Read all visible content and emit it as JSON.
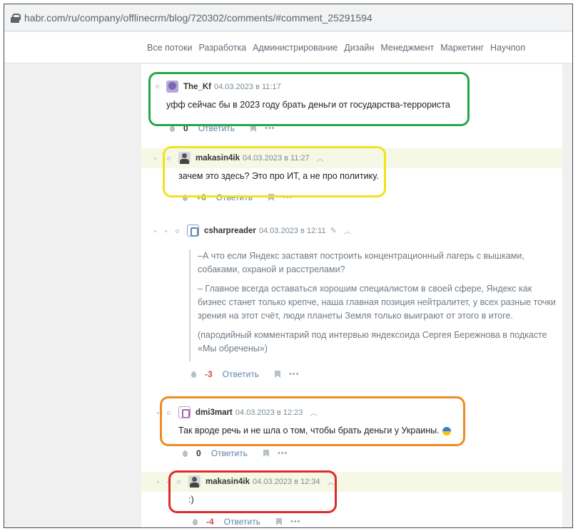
{
  "browser": {
    "url": "habr.com/ru/company/offlinecrm/blog/720302/comments/#comment_25291594"
  },
  "nav": {
    "items": [
      "Все потоки",
      "Разработка",
      "Администрирование",
      "Дизайн",
      "Менеджмент",
      "Маркетинг",
      "Научпоп"
    ]
  },
  "comments": [
    {
      "user": "The_Kf",
      "time": "04.03.2023 в 11:17",
      "text": "уфф сейчас бы в 2023 году брать деньги от государства-террориста",
      "score": "0",
      "reply": "Ответить",
      "more": "•••"
    },
    {
      "user": "makasin4ik",
      "time": "04.03.2023 в 11:27",
      "text": "зачем это здесь? Это про ИТ, а не про политику.",
      "score": "+6",
      "reply": "Ответить",
      "more": "•••"
    },
    {
      "user": "csharpreader",
      "time": "04.03.2023 в 12:11",
      "quote": [
        "–А что если Яндекс заставят построить концентрационный лагерь с вышками, собаками, охраной и расстрелами?",
        "– Главное всегда оставаться хорошим специалистом в своей сфере, Яндекс как бизнес станет только крепче, наша главная позиция нейтралитет, у всех разные точки зрения на этот счёт, люди планеты Земля только выиграют от этого в итоге.",
        "(пародийный комментарий под интервью яндексоида Сергея Бережнова в подкасте «Мы обречены»)"
      ],
      "score": "-3",
      "reply": "Ответить",
      "more": "•••"
    },
    {
      "user": "dmi3mart",
      "time": "04.03.2023 в 12:23",
      "text": "Так вроде речь и не шла о том, чтобы брать деньги у Украины.",
      "score": "0",
      "reply": "Ответить",
      "more": "•••"
    },
    {
      "user": "makasin4ik",
      "time": "04.03.2023 в 12:34",
      "text": ":)",
      "score": "-4",
      "reply": "Ответить",
      "more": "•••"
    }
  ],
  "annotation_colors": [
    "#22a84a",
    "#f2e21b",
    "#f08a24",
    "#e02a2a"
  ]
}
